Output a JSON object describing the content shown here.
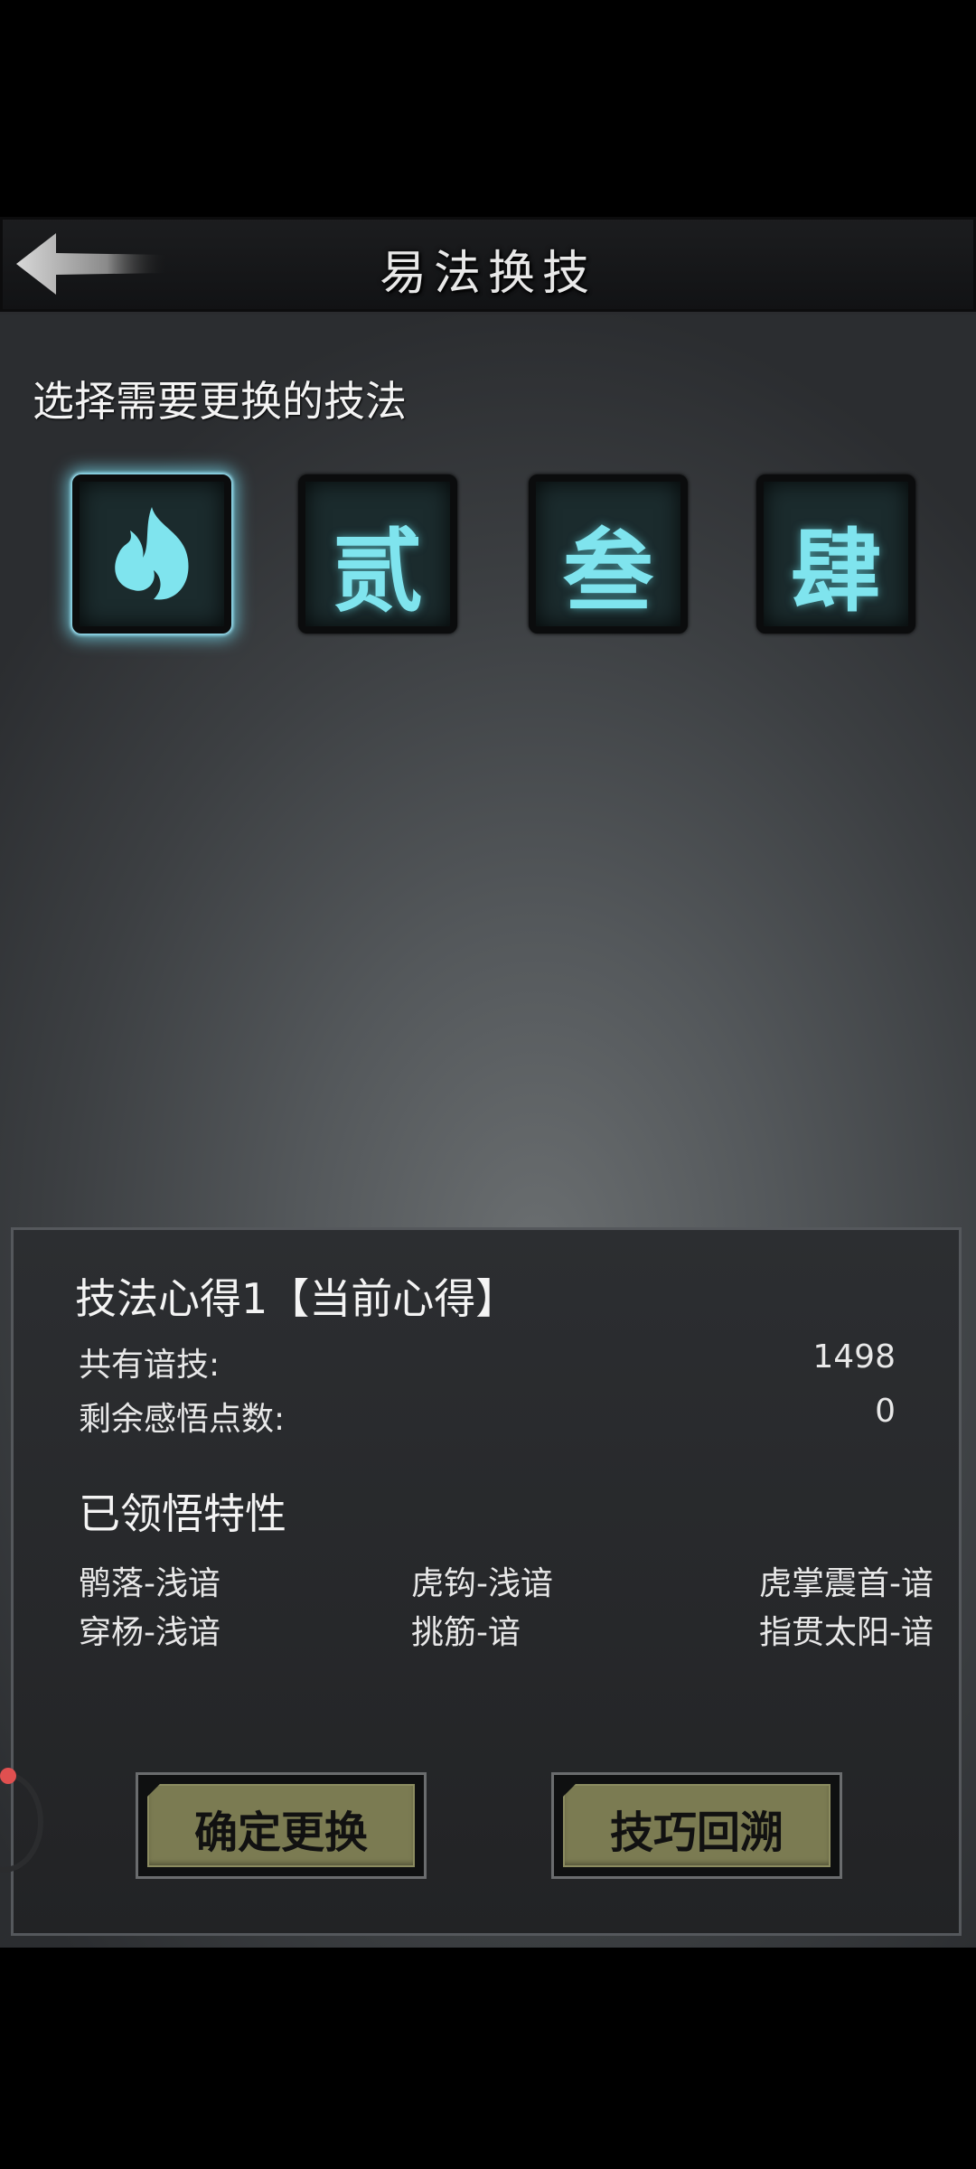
{
  "header": {
    "title": "易法换技"
  },
  "section_label": "选择需要更换的技法",
  "slots": [
    {
      "icon": "flame-icon",
      "char": ""
    },
    {
      "icon": "char-icon",
      "char": "贰"
    },
    {
      "icon": "char-icon",
      "char": "叁"
    },
    {
      "icon": "char-icon",
      "char": "肆"
    }
  ],
  "selected_slot": 0,
  "panel": {
    "title": "技法心得1【当前心得】",
    "stats": [
      {
        "label": "共有谙技:",
        "value": "1498"
      },
      {
        "label": "剩余感悟点数:",
        "value": "0"
      }
    ],
    "traits_title": "已领悟特性",
    "traits": [
      [
        "鹘落-浅谙",
        "虎钩-浅谙",
        "虎掌震首-谙"
      ],
      [
        "穿杨-浅谙",
        "挑筋-谙",
        "指贯太阳-谙"
      ]
    ],
    "buttons": {
      "confirm": "确定更换",
      "revert": "技巧回溯"
    }
  },
  "colors": {
    "glow": "#7fe4ee",
    "button": "#7b7b52"
  }
}
